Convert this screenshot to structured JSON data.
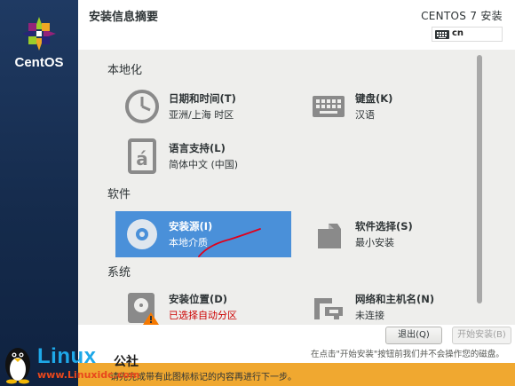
{
  "sidebar": {
    "brand": "CentOS"
  },
  "header": {
    "title": "安装信息摘要",
    "product": "CENTOS 7 安装",
    "keyboard_layout": "cn"
  },
  "sections": {
    "localization": "本地化",
    "software": "软件",
    "system": "系统"
  },
  "spokes": {
    "datetime": {
      "title": "日期和时间(T)",
      "status": "亚洲/上海 时区",
      "icon": "clock-icon"
    },
    "keyboard": {
      "title": "键盘(K)",
      "status": "汉语",
      "icon": "keyboard-icon"
    },
    "language": {
      "title": "语言支持(L)",
      "status": "简体中文 (中国)",
      "icon": "language-icon"
    },
    "source": {
      "title": "安装源(I)",
      "status": "本地介质",
      "icon": "disc-icon",
      "selected": true
    },
    "software": {
      "title": "软件选择(S)",
      "status": "最小安装",
      "icon": "package-icon"
    },
    "destination": {
      "title": "安装位置(D)",
      "status": "已选择自动分区",
      "icon": "harddisk-warning-icon",
      "status_color": "#cc0000"
    },
    "network": {
      "title": "网络和主机名(N)",
      "status": "未连接",
      "icon": "network-icon"
    }
  },
  "buttons": {
    "quit": "退出(Q)",
    "begin": "开始安装(B)"
  },
  "hint": "在点击\"开始安装\"按钮前我们并不会操作您的磁盘。",
  "warning": "请先完成带有此图标标记的内容再进行下一步。",
  "watermark": {
    "linux": "Linux",
    "cn": "公社",
    "url": "www.Linuxidc.com"
  },
  "colors": {
    "sidebar": "#1f3a63",
    "selected": "#4a90d9",
    "warning_bar": "#f0a830",
    "annotation": "#e0001b"
  }
}
